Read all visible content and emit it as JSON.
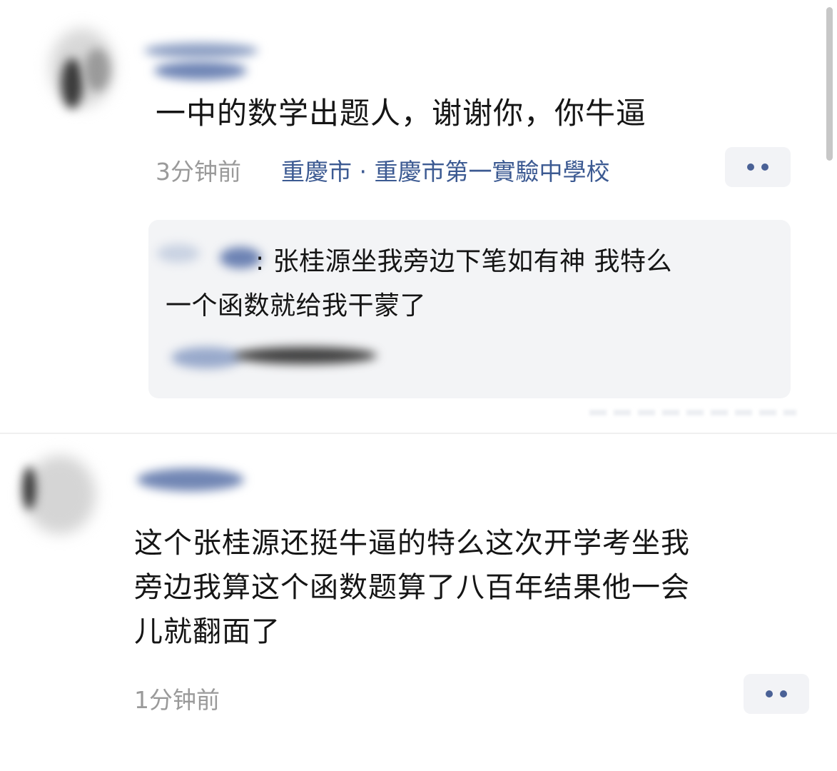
{
  "comments": [
    {
      "text": "一中的数学出题人，谢谢你，你牛逼",
      "time": "3分钟前",
      "location": "重慶市 · 重慶市第一實驗中學校",
      "reply": {
        "lines": [
          ": 张桂源坐我旁边下笔如有神 我特么",
          "一个函数就给我干蒙了"
        ]
      }
    },
    {
      "lines": [
        "这个张桂源还挺牛逼的特么这次开学考坐我",
        "旁边我算这个函数题算了八百年结果他一会",
        "儿就翻面了"
      ],
      "time": "1分钟前"
    }
  ],
  "colors": {
    "link_blue": "#3c5a92",
    "meta_gray": "#9a9a9a",
    "reply_bg": "#f3f4f6",
    "button_bg": "#f2f3f6"
  },
  "icons": {
    "more": "more-dots-icon"
  }
}
